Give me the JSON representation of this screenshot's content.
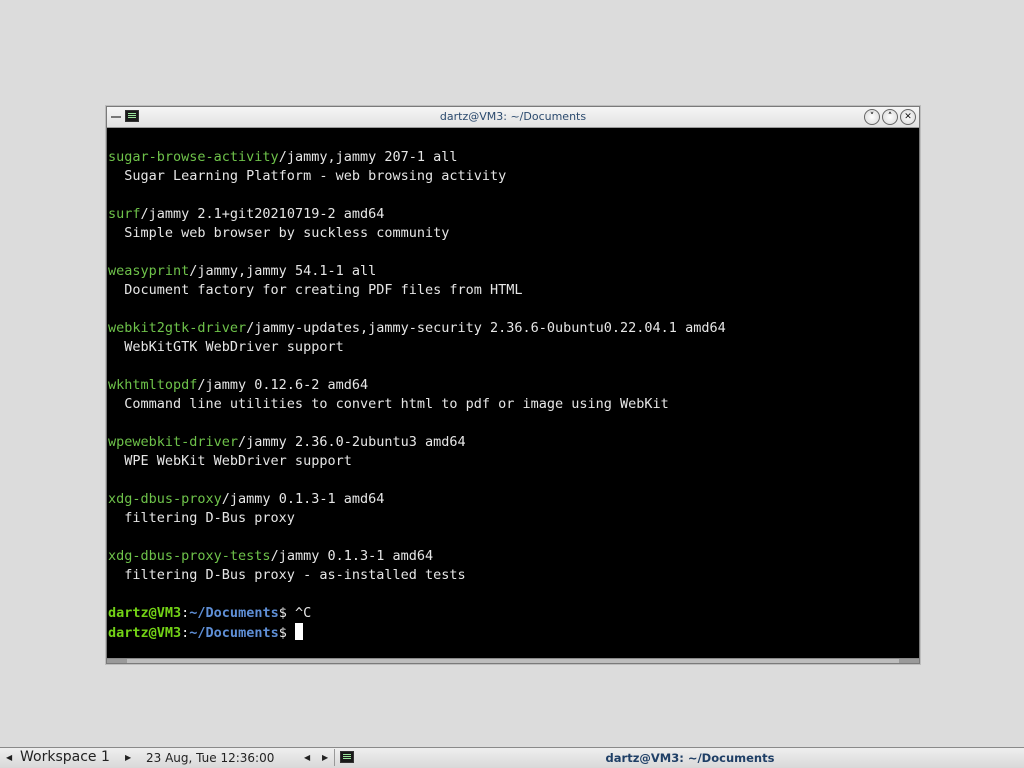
{
  "window": {
    "title": "dartz@VM3: ~/Documents"
  },
  "terminal": {
    "lines": [
      {
        "pkg": "sugar-browse-activity",
        "rest": "/jammy,jammy 207-1 all"
      },
      {
        "text": "  Sugar Learning Platform - web browsing activity"
      },
      {
        "text": ""
      },
      {
        "pkg": "surf",
        "rest": "/jammy 2.1+git20210719-2 amd64"
      },
      {
        "text": "  Simple web browser by suckless community"
      },
      {
        "text": ""
      },
      {
        "pkg": "weasyprint",
        "rest": "/jammy,jammy 54.1-1 all"
      },
      {
        "text": "  Document factory for creating PDF files from HTML"
      },
      {
        "text": ""
      },
      {
        "pkg": "webkit2gtk-driver",
        "rest": "/jammy-updates,jammy-security 2.36.6-0ubuntu0.22.04.1 amd64"
      },
      {
        "text": "  WebKitGTK WebDriver support"
      },
      {
        "text": ""
      },
      {
        "pkg": "wkhtmltopdf",
        "rest": "/jammy 0.12.6-2 amd64"
      },
      {
        "text": "  Command line utilities to convert html to pdf or image using WebKit"
      },
      {
        "text": ""
      },
      {
        "pkg": "wpewebkit-driver",
        "rest": "/jammy 2.36.0-2ubuntu3 amd64"
      },
      {
        "text": "  WPE WebKit WebDriver support"
      },
      {
        "text": ""
      },
      {
        "pkg": "xdg-dbus-proxy",
        "rest": "/jammy 0.1.3-1 amd64"
      },
      {
        "text": "  filtering D-Bus proxy"
      },
      {
        "text": ""
      },
      {
        "pkg": "xdg-dbus-proxy-tests",
        "rest": "/jammy 0.1.3-1 amd64"
      },
      {
        "text": "  filtering D-Bus proxy - as-installed tests"
      },
      {
        "text": ""
      }
    ],
    "prompts": [
      {
        "user": "dartz@VM3",
        "colon": ":",
        "path": "~/Documents",
        "dollar": "$ ",
        "input": "^C",
        "cursor": false
      },
      {
        "user": "dartz@VM3",
        "colon": ":",
        "path": "~/Documents",
        "dollar": "$ ",
        "input": "",
        "cursor": true
      }
    ]
  },
  "taskbar": {
    "workspace": "Workspace 1",
    "clock": "23 Aug, Tue 12:36:00",
    "task_title": "dartz@VM3: ~/Documents",
    "prev_arrow": "◀",
    "next_arrow": "▶"
  },
  "colors": {
    "package_name": "#6ec24a",
    "prompt_user": "#73d216",
    "prompt_path": "#5f8fd6",
    "terminal_bg": "#000000"
  },
  "icons": {
    "window_menu": "window-menu-icon",
    "app": "terminal-icon",
    "minimize": "minimize-icon",
    "maximize": "maximize-icon",
    "close": "close-icon"
  }
}
